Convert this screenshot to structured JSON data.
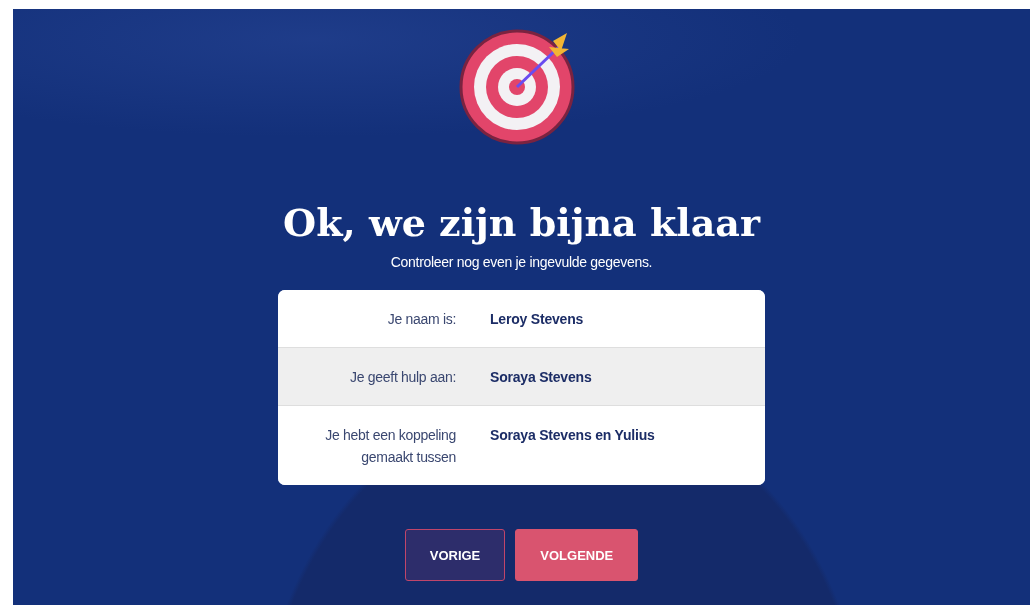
{
  "heading": "Ok, we zijn bijna klaar",
  "subheading": "Controleer nog even je ingevulde gegevens.",
  "summary": [
    {
      "label": "Je naam is:",
      "value": "Leroy Stevens"
    },
    {
      "label": "Je geeft hulp aan:",
      "value": "Soraya Stevens"
    },
    {
      "label": "Je hebt een koppeling gemaakt tussen",
      "value": "Soraya Stevens en Yulius"
    }
  ],
  "buttons": [
    {
      "label": "VORIGE",
      "kind": "secondary"
    },
    {
      "label": "VOLGENDE",
      "kind": "primary"
    }
  ]
}
